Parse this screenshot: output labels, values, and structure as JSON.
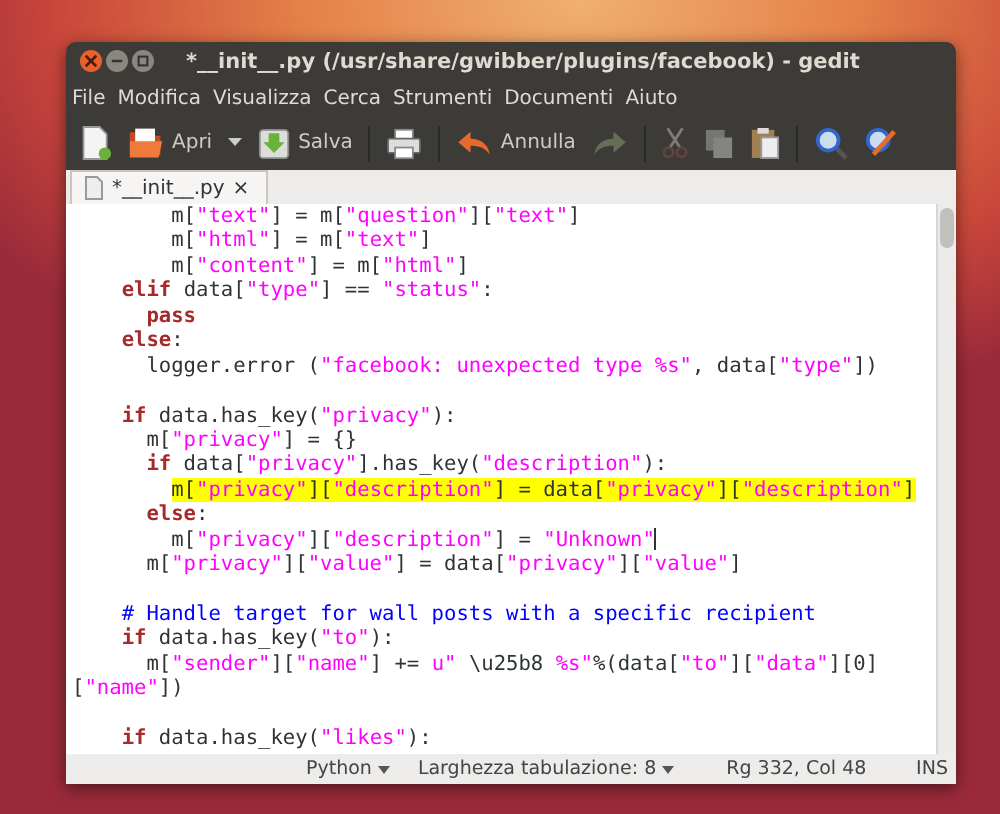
{
  "window": {
    "title": "*__init__.py (/usr/share/gwibber/plugins/facebook) - gedit"
  },
  "menu": [
    "File",
    "Modifica",
    "Visualizza",
    "Cerca",
    "Strumenti",
    "Documenti",
    "Aiuto"
  ],
  "toolbar": [
    {
      "kind": "new",
      "disabled": false
    },
    {
      "kind": "open",
      "label": "Apri",
      "disabled": false
    },
    {
      "kind": "dropdown",
      "disabled": false
    },
    {
      "kind": "save",
      "label": "Salva",
      "disabled": false
    },
    {
      "kind": "separator"
    },
    {
      "kind": "print",
      "disabled": false
    },
    {
      "kind": "separator"
    },
    {
      "kind": "undo",
      "label": "Annulla",
      "disabled": false
    },
    {
      "kind": "redo",
      "disabled": true
    },
    {
      "kind": "separator"
    },
    {
      "kind": "cut",
      "disabled": true
    },
    {
      "kind": "copy",
      "disabled": true
    },
    {
      "kind": "paste",
      "disabled": false
    },
    {
      "kind": "separator"
    },
    {
      "kind": "find",
      "disabled": false
    },
    {
      "kind": "replace",
      "disabled": false
    }
  ],
  "tabs": [
    {
      "label": "*__init__.py",
      "selected": true,
      "close": "×"
    }
  ],
  "lines": [
    {
      "kind": "code",
      "tokens": [
        {
          "kind": "plain",
          "text": "        m["
        },
        {
          "kind": "string",
          "text": "\"text\""
        },
        {
          "kind": "plain",
          "text": "] = m["
        },
        {
          "kind": "string",
          "text": "\"question\""
        },
        {
          "kind": "plain",
          "text": "]["
        },
        {
          "kind": "string",
          "text": "\"text\""
        },
        {
          "kind": "plain",
          "text": "]"
        }
      ]
    },
    {
      "kind": "code",
      "tokens": [
        {
          "kind": "plain",
          "text": "        m["
        },
        {
          "kind": "string",
          "text": "\"html\""
        },
        {
          "kind": "plain",
          "text": "] = m["
        },
        {
          "kind": "string",
          "text": "\"text\""
        },
        {
          "kind": "plain",
          "text": "]"
        }
      ]
    },
    {
      "kind": "code",
      "tokens": [
        {
          "kind": "plain",
          "text": "        m["
        },
        {
          "kind": "string",
          "text": "\"content\""
        },
        {
          "kind": "plain",
          "text": "] = m["
        },
        {
          "kind": "string",
          "text": "\"html\""
        },
        {
          "kind": "plain",
          "text": "]"
        }
      ]
    },
    {
      "kind": "code",
      "tokens": [
        {
          "kind": "keyword",
          "text": "    elif"
        },
        {
          "kind": "plain",
          "text": " data["
        },
        {
          "kind": "string",
          "text": "\"type\""
        },
        {
          "kind": "plain",
          "text": "] == "
        },
        {
          "kind": "string",
          "text": "\"status\""
        },
        {
          "kind": "plain",
          "text": ":"
        }
      ]
    },
    {
      "kind": "code",
      "tokens": [
        {
          "kind": "keyword",
          "text": "      pass"
        }
      ]
    },
    {
      "kind": "code",
      "tokens": [
        {
          "kind": "keyword",
          "text": "    else"
        },
        {
          "kind": "plain",
          "text": ":"
        }
      ]
    },
    {
      "kind": "code",
      "tokens": [
        {
          "kind": "plain",
          "text": "      logger.error ("
        },
        {
          "kind": "string",
          "text": "\"facebook: unexpected type %s\""
        },
        {
          "kind": "plain",
          "text": ", data["
        },
        {
          "kind": "string",
          "text": "\"type\""
        },
        {
          "kind": "plain",
          "text": "])"
        }
      ]
    },
    {
      "kind": "blank"
    },
    {
      "kind": "code",
      "tokens": [
        {
          "kind": "keyword",
          "text": "    if"
        },
        {
          "kind": "plain",
          "text": " data.has_key("
        },
        {
          "kind": "string",
          "text": "\"privacy\""
        },
        {
          "kind": "plain",
          "text": "):"
        }
      ]
    },
    {
      "kind": "code",
      "tokens": [
        {
          "kind": "plain",
          "text": "      m["
        },
        {
          "kind": "string",
          "text": "\"privacy\""
        },
        {
          "kind": "plain",
          "text": "] = {}"
        }
      ]
    },
    {
      "kind": "code",
      "tokens": [
        {
          "kind": "keyword",
          "text": "      if"
        },
        {
          "kind": "plain",
          "text": " data["
        },
        {
          "kind": "string",
          "text": "\"privacy\""
        },
        {
          "kind": "plain",
          "text": "].has_key("
        },
        {
          "kind": "string",
          "text": "\"description\""
        },
        {
          "kind": "plain",
          "text": "):"
        }
      ]
    },
    {
      "kind": "code",
      "highlighted": true,
      "tokens": [
        {
          "kind": "plain",
          "text": "        m["
        },
        {
          "kind": "string",
          "text": "\"privacy\""
        },
        {
          "kind": "plain",
          "text": "]["
        },
        {
          "kind": "string",
          "text": "\"description\""
        },
        {
          "kind": "plain",
          "text": "] = data["
        },
        {
          "kind": "string",
          "text": "\"privacy\""
        },
        {
          "kind": "plain",
          "text": "]["
        },
        {
          "kind": "string",
          "text": "\"description\""
        },
        {
          "kind": "plain",
          "text": "]"
        }
      ]
    },
    {
      "kind": "code",
      "tokens": [
        {
          "kind": "keyword",
          "text": "      else"
        },
        {
          "kind": "plain",
          "text": ":"
        }
      ]
    },
    {
      "kind": "code",
      "cursor": true,
      "tokens": [
        {
          "kind": "plain",
          "text": "        m["
        },
        {
          "kind": "string",
          "text": "\"privacy\""
        },
        {
          "kind": "plain",
          "text": "]["
        },
        {
          "kind": "string",
          "text": "\"description\""
        },
        {
          "kind": "plain",
          "text": "] = "
        },
        {
          "kind": "string",
          "text": "\"Unknown\""
        }
      ]
    },
    {
      "kind": "code",
      "tokens": [
        {
          "kind": "plain",
          "text": "      m["
        },
        {
          "kind": "string",
          "text": "\"privacy\""
        },
        {
          "kind": "plain",
          "text": "]["
        },
        {
          "kind": "string",
          "text": "\"value\""
        },
        {
          "kind": "plain",
          "text": "] = data["
        },
        {
          "kind": "string",
          "text": "\"privacy\""
        },
        {
          "kind": "plain",
          "text": "]["
        },
        {
          "kind": "string",
          "text": "\"value\""
        },
        {
          "kind": "plain",
          "text": "]"
        }
      ]
    },
    {
      "kind": "blank"
    },
    {
      "kind": "code",
      "tokens": [
        {
          "kind": "comment",
          "text": "    # Handle target for wall posts with a specific recipient"
        }
      ]
    },
    {
      "kind": "code",
      "tokens": [
        {
          "kind": "keyword",
          "text": "    if"
        },
        {
          "kind": "plain",
          "text": " data.has_key("
        },
        {
          "kind": "string",
          "text": "\"to\""
        },
        {
          "kind": "plain",
          "text": "):"
        }
      ]
    },
    {
      "kind": "code",
      "tokens": [
        {
          "kind": "plain",
          "text": "      m["
        },
        {
          "kind": "string",
          "text": "\"sender\""
        },
        {
          "kind": "plain",
          "text": "]["
        },
        {
          "kind": "string",
          "text": "\"name\""
        },
        {
          "kind": "plain",
          "text": "] += "
        },
        {
          "kind": "string",
          "text": "u\" "
        },
        {
          "kind": "plain",
          "text": "\\u25b8"
        },
        {
          "kind": "string",
          "text": " %s\""
        },
        {
          "kind": "plain",
          "text": "%(data["
        },
        {
          "kind": "string",
          "text": "\"to\""
        },
        {
          "kind": "plain",
          "text": "]["
        },
        {
          "kind": "string",
          "text": "\"data\""
        },
        {
          "kind": "plain",
          "text": "][0]"
        }
      ]
    },
    {
      "kind": "code",
      "tokens": [
        {
          "kind": "plain",
          "text": "["
        },
        {
          "kind": "string",
          "text": "\"name\""
        },
        {
          "kind": "plain",
          "text": "])"
        }
      ]
    },
    {
      "kind": "blank"
    },
    {
      "kind": "code",
      "tokens": [
        {
          "kind": "keyword",
          "text": "    if"
        },
        {
          "kind": "plain",
          "text": " data.has_key("
        },
        {
          "kind": "string",
          "text": "\"likes\""
        },
        {
          "kind": "plain",
          "text": "):"
        }
      ]
    }
  ],
  "status_bar": [
    {
      "kind": "dropdown",
      "text": "Python"
    },
    {
      "kind": "dropdown",
      "text": "Larghezza tabulazione: 8"
    },
    {
      "kind": "text",
      "text": "Rg 332, Col 48"
    },
    {
      "kind": "text",
      "text": "INS"
    }
  ]
}
